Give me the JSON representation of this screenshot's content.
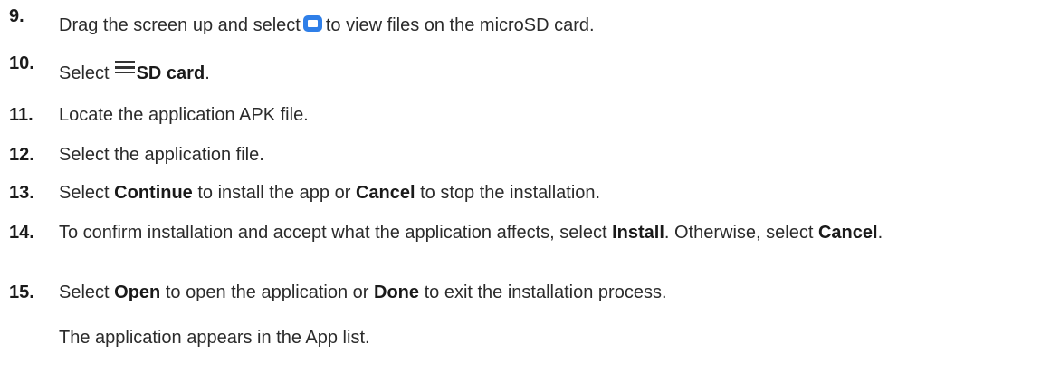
{
  "steps": [
    {
      "num": "9.",
      "pre": "Drag the screen up and select",
      "icon": "folder-icon",
      "post": "to view files on the microSD card."
    },
    {
      "num": "10.",
      "pre": "Select",
      "icon": "menu-icon",
      "bold": "SD card",
      "post": "."
    },
    {
      "num": "11.",
      "text": "Locate the application APK file."
    },
    {
      "num": "12.",
      "text": "Select the application file."
    },
    {
      "num": "13.",
      "pre": "Select",
      "bold1": "Continue",
      "mid": "to install the app or",
      "bold2": "Cancel",
      "post": "to stop the installation."
    },
    {
      "num": "14.",
      "pre": "To confirm installation and accept what the application affects, select",
      "bold1": "Install",
      "mid": ". Otherwise, select",
      "bold2": "Cancel",
      "post": "."
    },
    {
      "num": "15.",
      "pre": "Select",
      "bold1": "Open",
      "mid": "to open the application or",
      "bold2": "Done",
      "post": "to exit the installation process."
    }
  ],
  "result_text": "The application appears in the App list."
}
